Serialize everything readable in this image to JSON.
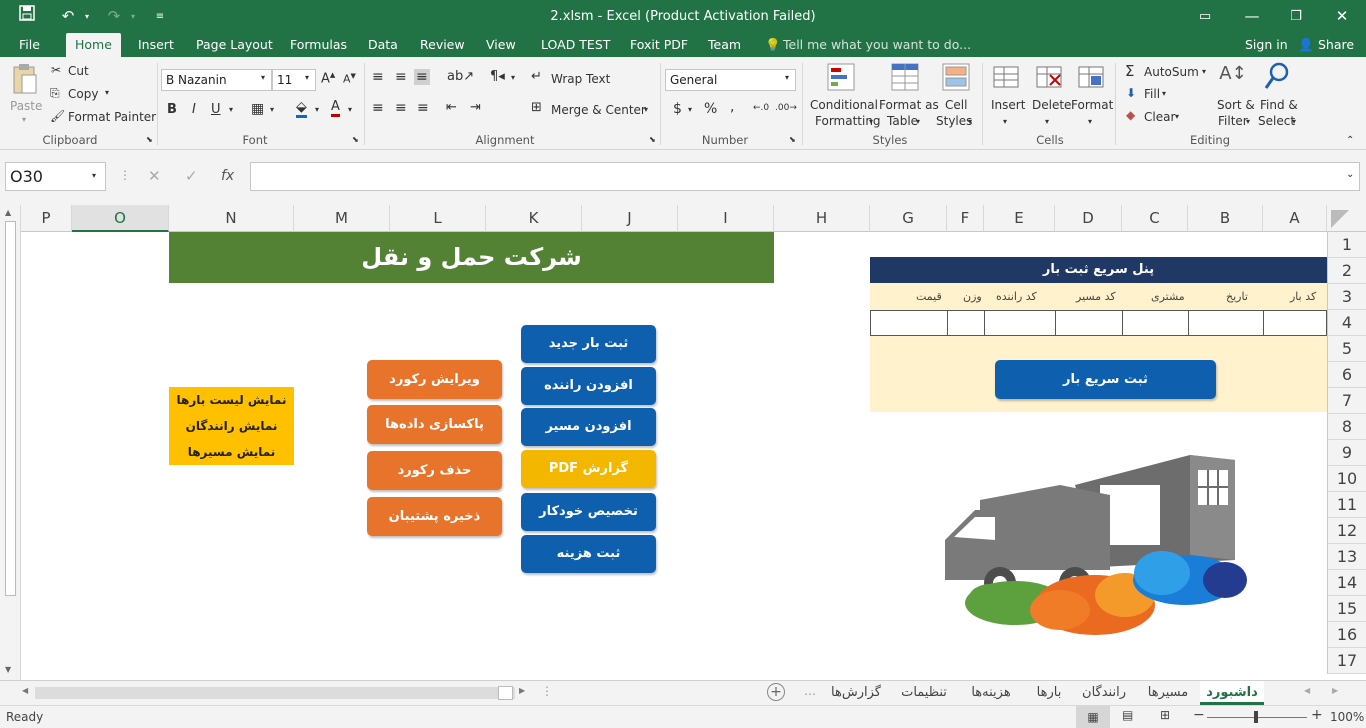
{
  "titlebar": {
    "title": "2.xlsm - Excel (Product Activation Failed)"
  },
  "tabs": [
    "File",
    "Home",
    "Insert",
    "Page Layout",
    "Formulas",
    "Data",
    "Review",
    "View",
    "LOAD TEST",
    "Foxit PDF",
    "Team"
  ],
  "tell_me": "Tell me what you want to do...",
  "account": {
    "signin": "Sign in",
    "share": "Share"
  },
  "ribbon": {
    "clipboard": {
      "paste": "Paste",
      "cut": "Cut",
      "copy": "Copy",
      "format_painter": "Format Painter",
      "label": "Clipboard"
    },
    "font": {
      "name": "B Nazanin",
      "size": "11",
      "label": "Font",
      "bold": "B",
      "italic": "I",
      "underline": "U"
    },
    "alignment": {
      "wrap": "Wrap Text",
      "merge": "Merge & Center",
      "label": "Alignment"
    },
    "number": {
      "format": "General",
      "label": "Number",
      "currency": "$",
      "percent": "%",
      "comma": ","
    },
    "styles": {
      "cond1": "Conditional",
      "cond2": "Formatting",
      "fmt1": "Format as",
      "fmt2": "Table",
      "cell1": "Cell",
      "cell2": "Styles",
      "label": "Styles"
    },
    "cells": {
      "insert": "Insert",
      "delete": "Delete",
      "format": "Format",
      "label": "Cells"
    },
    "editing": {
      "autosum": "AutoSum",
      "fill": "Fill",
      "clear": "Clear",
      "sort1": "Sort &",
      "sort2": "Filter",
      "find1": "Find &",
      "find2": "Select",
      "label": "Editing"
    }
  },
  "formula_bar": {
    "namebox": "O30",
    "formula": "",
    "fx": "fx"
  },
  "columns": [
    "P",
    "O",
    "N",
    "M",
    "L",
    "K",
    "J",
    "I",
    "H",
    "G",
    "F",
    "E",
    "D",
    "C",
    "B",
    "A"
  ],
  "rows": [
    "1",
    "2",
    "3",
    "4",
    "5",
    "6",
    "7",
    "8",
    "9",
    "10",
    "11",
    "12",
    "13",
    "14",
    "15",
    "16",
    "17"
  ],
  "sheet": {
    "banner": "شرکت حمل و نقل",
    "panel_title": "پنل سریع ثبت بار",
    "panel_headers": [
      "قیمت",
      "وزن",
      "کد راننده",
      "کد مسیر",
      "مشتری",
      "تاریخ",
      "کد بار"
    ],
    "panel_button": "ثبت سریع بار",
    "blue_buttons": [
      "ثبت بار جدید",
      "افزودن راننده",
      "افزودن مسیر",
      "گزارش PDF",
      "تخصیص خودکار",
      "ثبت هزینه"
    ],
    "orange_buttons": [
      "ویرایش رکورد",
      "پاکسازی داده‌ها",
      "حذف رکورد",
      "ذخیره پشتیبان"
    ],
    "list_box": [
      "نمایش لیست بارها",
      "نمایش رانندگان",
      "نمایش مسیرها"
    ]
  },
  "sheet_tabs": [
    "داشبورد",
    "مسیرها",
    "رانندگان",
    "بارها",
    "هزینه‌ها",
    "تنظیمات",
    "گزارش‌ها"
  ],
  "status": {
    "ready": "Ready",
    "zoom": "100%"
  },
  "colors": {
    "excel_green": "#217346",
    "banner_green": "#548235",
    "navy": "#1f3864",
    "cream": "#fff2cc",
    "blue": "#0e5fae",
    "orange": "#e8732a",
    "gold": "#ffc000"
  }
}
